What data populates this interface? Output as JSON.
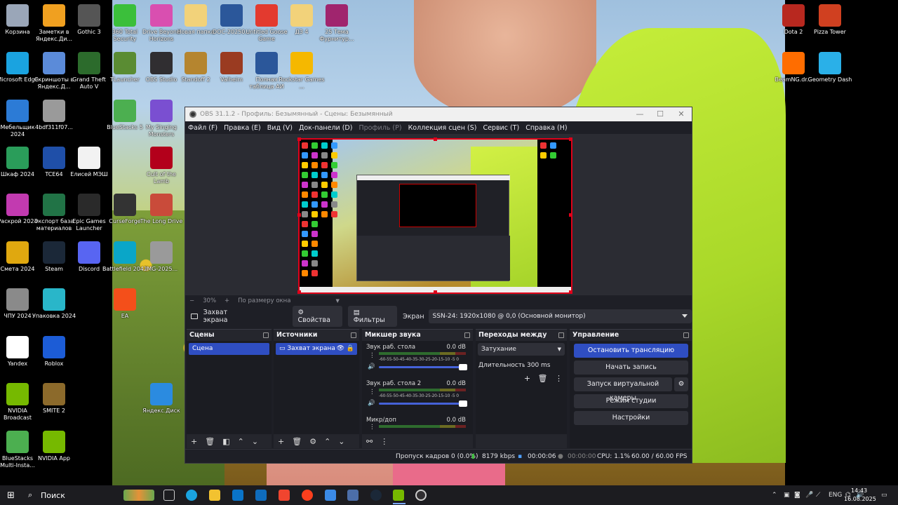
{
  "desktop": {
    "icons": [
      {
        "label": "Корзина",
        "icon": "recycle-bin-icon",
        "color": "#9aa6b8"
      },
      {
        "label": "Заметки в Яндекс.Ди...",
        "icon": "notes-icon",
        "color": "#f0a020"
      },
      {
        "label": "Gothic 3",
        "icon": "gothic-icon",
        "color": "#555555"
      },
      {
        "label": "360 Total Security",
        "icon": "360-security-icon",
        "color": "#3bbf3b"
      },
      {
        "label": "Drive Beyond Horizons",
        "icon": "game-icon",
        "color": "#d94fb0"
      },
      {
        "label": "Новая папка",
        "icon": "folder-icon",
        "color": "#f2d27a"
      },
      {
        "label": "DOC-20250...",
        "icon": "word-doc-icon",
        "color": "#2b579a"
      },
      {
        "label": "Untitled Goose Game",
        "icon": "goose-game-icon",
        "color": "#e33a2f"
      },
      {
        "label": "ДЗ 4",
        "icon": "folder-icon",
        "color": "#f2d27a"
      },
      {
        "label": "25 Тема Фурнитур...",
        "icon": "winrar-icon",
        "color": "#a0256e"
      },
      {
        "label": "Microsoft Edge",
        "icon": "edge-icon",
        "color": "#1aa3e0"
      },
      {
        "label": "Скриншоты в Яндекс.Д...",
        "icon": "screenshot-folder-icon",
        "color": "#5b8bd9"
      },
      {
        "label": "Grand Theft Auto V",
        "icon": "gta-icon",
        "color": "#2c6b2c"
      },
      {
        "label": "TLauncher",
        "icon": "minecraft-icon",
        "color": "#5a8c33"
      },
      {
        "label": "OBS Studio",
        "icon": "obs-icon",
        "color": "#302e31"
      },
      {
        "label": "Standoff 2",
        "icon": "standoff-icon",
        "color": "#b5852f"
      },
      {
        "label": "Valheim",
        "icon": "valheim-icon",
        "color": "#9a3b21"
      },
      {
        "label": "Полная таблица АИ",
        "icon": "word-doc-icon",
        "color": "#2b579a"
      },
      {
        "label": "Rockstar Games ...",
        "icon": "rockstar-icon",
        "color": "#f5b800"
      },
      {
        "label": "Мебельщик 2024",
        "icon": "app-icon",
        "color": "#2c7bd6"
      },
      {
        "label": "4bdf311f07...",
        "icon": "image-file-icon",
        "color": "#9a9a9a"
      },
      {
        "label": "BlueStacks 5",
        "icon": "bluestacks-icon",
        "color": "#4caf50"
      },
      {
        "label": "My Singing Monsters",
        "icon": "game-icon",
        "color": "#7a4fd1"
      },
      {
        "label": "Шкаф 2024",
        "icon": "app-icon",
        "color": "#2a9d5a"
      },
      {
        "label": "TCE64",
        "icon": "app-icon",
        "color": "#1f4fa8"
      },
      {
        "label": "Елисей МЭШ",
        "icon": "document-icon",
        "color": "#f2f2f2"
      },
      {
        "label": "Cult of the Lamb",
        "icon": "game-icon",
        "color": "#b3001b"
      },
      {
        "label": "Раскрой 2024",
        "icon": "app-icon",
        "color": "#c23ab0"
      },
      {
        "label": "Экспорт база материалов",
        "icon": "excel-icon",
        "color": "#217346"
      },
      {
        "label": "Epic Games Launcher",
        "icon": "epic-games-icon",
        "color": "#2a2a2a"
      },
      {
        "label": "CurseForge",
        "icon": "curseforge-icon",
        "color": "#333333"
      },
      {
        "label": "The Long Drive",
        "icon": "car-game-icon",
        "color": "#c94b3a"
      },
      {
        "label": "Смета 2024",
        "icon": "app-icon",
        "color": "#e0a80f"
      },
      {
        "label": "Steam",
        "icon": "steam-icon",
        "color": "#1b2838"
      },
      {
        "label": "Discord",
        "icon": "discord-icon",
        "color": "#5865f2"
      },
      {
        "label": "Battlefield 2042",
        "icon": "battlefield-icon",
        "color": "#0aa6c8"
      },
      {
        "label": "IMG-2025...",
        "icon": "image-file-icon",
        "color": "#9a9a9a"
      },
      {
        "label": "ЧПУ 2024",
        "icon": "app-icon",
        "color": "#8a8a8a"
      },
      {
        "label": "Упаковка 2024",
        "icon": "app-icon",
        "color": "#29b6c9"
      },
      {
        "label": "EA",
        "icon": "ea-icon",
        "color": "#f44f1a"
      },
      {
        "label": "Yandex",
        "icon": "yandex-icon",
        "color": "#ffffff"
      },
      {
        "label": "Roblox",
        "icon": "roblox-icon",
        "color": "#1c5cd6"
      },
      {
        "label": "Яндекс.Диск",
        "icon": "yandex-disk-icon",
        "color": "#2b8be0"
      },
      {
        "label": "NVIDIA Broadcast",
        "icon": "nvidia-icon",
        "color": "#76b900"
      },
      {
        "label": "SMITE 2",
        "icon": "smite-icon",
        "color": "#8c6a2b"
      },
      {
        "label": "BlueStacks Multi-Insta...",
        "icon": "bluestacks-icon",
        "color": "#4caf50"
      },
      {
        "label": "NVIDIA App",
        "icon": "nvidia-icon",
        "color": "#76b900"
      },
      {
        "label": "Dota 2",
        "icon": "dota-icon",
        "color": "#b8281f"
      },
      {
        "label": "Pizza Tower",
        "icon": "game-icon",
        "color": "#d04020"
      },
      {
        "label": "BeamNG.dr...",
        "icon": "beamng-icon",
        "color": "#ff6d00"
      },
      {
        "label": "Geometry Dash",
        "icon": "geometry-dash-icon",
        "color": "#2ab0e8"
      }
    ]
  },
  "obs": {
    "title": "OBS 31.1.2 - Профиль: Безымянный - Сцены: Безымянный",
    "menu": [
      "Файл (F)",
      "Правка (E)",
      "Вид (V)",
      "Док-панели (D)",
      "Профиль (P)",
      "Коллекция сцен (S)",
      "Сервис (T)",
      "Справка (H)"
    ],
    "zoom": {
      "minus": "−",
      "value": "30%",
      "plus": "+",
      "fit": "По размеру окна"
    },
    "source_bar": {
      "source": "Захват экрана",
      "properties": "Свойства",
      "filters": "Фильтры",
      "screen_label": "Экран",
      "screen_value": "SSN-24: 1920x1080 @ 0,0 (Основной монитор)"
    },
    "scenes": {
      "title": "Сцены",
      "items": [
        "Сцена"
      ]
    },
    "sources": {
      "title": "Источники",
      "items": [
        "Захват экрана"
      ]
    },
    "mixer": {
      "title": "Микшер звука",
      "scale": "-60-55-50-45-40-35-30-25-20-15-10 -5 0",
      "channels": [
        {
          "name": "Звук раб. стола",
          "db": "0.0 dB"
        },
        {
          "name": "Звук раб. стола 2",
          "db": "0.0 dB"
        },
        {
          "name": "Микр/доп",
          "db": "0.0 dB"
        }
      ]
    },
    "transitions": {
      "title": "Переходы между сце...",
      "type": "Затухание",
      "duration_label": "Длительность",
      "duration_value": "300 ms"
    },
    "controls": {
      "title": "Управление",
      "stop_stream": "Остановить трансляцию",
      "start_record": "Начать запись",
      "virtual_cam": "Запуск виртуальной камеры",
      "studio_mode": "Режим студии",
      "settings": "Настройки"
    },
    "status": {
      "dropped": "Пропуск кадров 0 (0.0%)",
      "bitrate": "8179 kbps",
      "stream_time": "00:00:06",
      "record_time": "00:00:00",
      "cpu": "CPU: 1.1%",
      "fps": "60.00 / 60.00 FPS"
    }
  },
  "taskbar": {
    "search": "Поиск",
    "language": "ENG",
    "time": "14:43",
    "date": "16.08.2025",
    "accent": "#2f4ec2"
  }
}
